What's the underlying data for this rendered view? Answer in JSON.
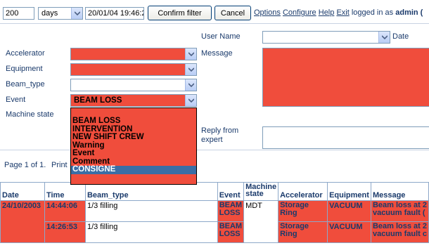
{
  "toolbar": {
    "count_value": "200",
    "unit_value": "days",
    "date_value": "20/01/04 19:46:2",
    "confirm_label": "Confirm filter",
    "cancel_label": "Cancel",
    "options_label": "Options",
    "configure_label": "Configure",
    "help_label": "Help",
    "exit_label": "Exit",
    "logged_in_text": "logged in as",
    "user_name": "admin ("
  },
  "form": {
    "user_name_label": "User Name",
    "date_label": "Date",
    "accelerator_label": "Accelerator",
    "message_label": "Message",
    "equipment_label": "Equipment",
    "beam_type_label": "Beam_type",
    "event_label": "Event",
    "event_value": "BEAM LOSS",
    "machine_state_label": "Machine state",
    "reply_label_1": "Reply from",
    "reply_label_2": "expert"
  },
  "event_dropdown": {
    "items": [
      "BEAM LOSS",
      "INTERVENTION",
      "NEW SHIFT CREW",
      "Warning",
      "Event",
      "Comment",
      "CONSIGNE"
    ],
    "selected_index": 6
  },
  "pagination": {
    "text": "Page 1 of 1.",
    "print_label": "Print"
  },
  "table": {
    "headers": [
      "Date",
      "Time",
      "Beam_type",
      "Event",
      "Machine",
      "state",
      "Accelerator",
      "Equipment",
      "Message"
    ],
    "rows": [
      {
        "date": "24/10/2003",
        "time": "14:44:06",
        "beam_type": "1/3 filling",
        "event_1": "BEAM",
        "event_2": "LOSS",
        "machine_state": "MDT",
        "accelerator_1": "Storage",
        "accelerator_2": "Ring",
        "equipment": "VACUUM",
        "message_1": "Beam loss at 2",
        "message_2": "vacuum fault ("
      },
      {
        "date": "",
        "time": "14:26:53",
        "beam_type": "1/3 filling",
        "event_1": "BEAM",
        "event_2": "LOSS",
        "machine_state": "",
        "accelerator_1": "Storage",
        "accelerator_2": "Ring",
        "equipment": "VACUUM",
        "message_1": "Beam loss at 2",
        "message_2": "vacuum fault c"
      }
    ]
  },
  "colors": {
    "highlight_red": "#f04d3c",
    "text_navy": "#1a3a6b",
    "selection_blue": "#3a6ea5"
  }
}
